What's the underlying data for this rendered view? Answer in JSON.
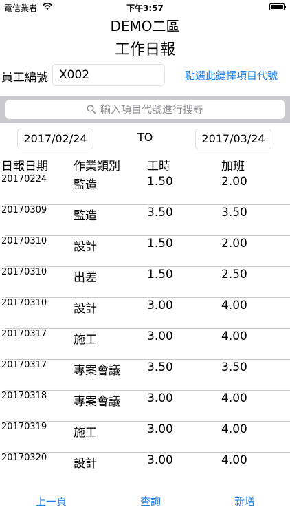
{
  "status_bar": {
    "carrier": "電信業者",
    "time": "下午3:57"
  },
  "header": {
    "company": "DEMO二區",
    "title": "工作日報"
  },
  "employee": {
    "label": "員工編號",
    "value": "X002",
    "select_link": "點選此鍵擇項目代號"
  },
  "search": {
    "placeholder": "輸入項目代號進行搜尋"
  },
  "date_range": {
    "start": "2017/02/24",
    "separator": "TO",
    "end": "2017/03/24"
  },
  "table": {
    "headers": [
      "日報日期",
      "作業類別",
      "工時",
      "加班"
    ],
    "rows": [
      {
        "date": "20170224",
        "type": "監造",
        "hours": "1.50",
        "overtime": "2.00"
      },
      {
        "date": "20170309",
        "type": "監造",
        "hours": "3.50",
        "overtime": "3.50"
      },
      {
        "date": "20170310",
        "type": "設計",
        "hours": "1.50",
        "overtime": "2.00"
      },
      {
        "date": "20170310",
        "type": "出差",
        "hours": "1.50",
        "overtime": "2.50"
      },
      {
        "date": "20170310",
        "type": "設計",
        "hours": "3.00",
        "overtime": "4.00"
      },
      {
        "date": "20170317",
        "type": "施工",
        "hours": "3.00",
        "overtime": "4.00"
      },
      {
        "date": "20170317",
        "type": "專案會議",
        "hours": "3.50",
        "overtime": "3.50"
      },
      {
        "date": "20170318",
        "type": "專案會議",
        "hours": "3.00",
        "overtime": "4.00"
      },
      {
        "date": "20170319",
        "type": "施工",
        "hours": "3.00",
        "overtime": "4.00"
      },
      {
        "date": "20170320",
        "type": "設計",
        "hours": "3.00",
        "overtime": "4.00"
      }
    ]
  },
  "toolbar": {
    "prev_label": "上一頁",
    "query_label": "查詢",
    "add_label": "新增"
  },
  "colors": {
    "accent": "#1a7ee6",
    "search_bar_bg": "#c9c9ce",
    "placeholder": "#8e8e93"
  }
}
